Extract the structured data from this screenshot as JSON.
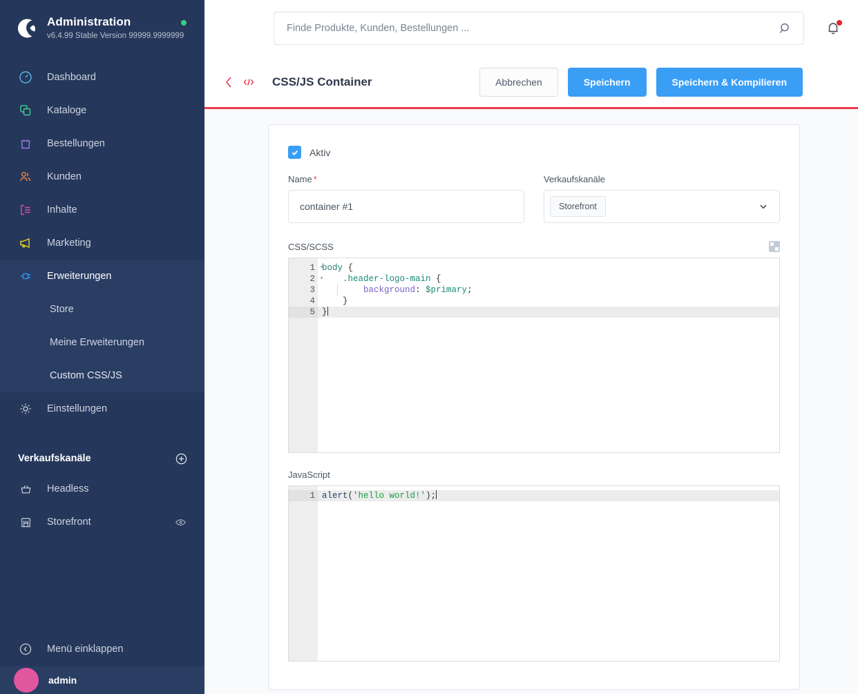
{
  "sidebar": {
    "brand": {
      "logo_icon": "shopware-logo-icon",
      "title": "Administration",
      "version": "v6.4.99 Stable Version 99999.9999999",
      "status_dot_color": "#37d183"
    },
    "nav": [
      {
        "label": "Dashboard",
        "icon": "speedometer-icon",
        "color": "#5ab9e8"
      },
      {
        "label": "Kataloge",
        "icon": "layers-icon",
        "color": "#3ecf8e"
      },
      {
        "label": "Bestellungen",
        "icon": "bag-icon",
        "color": "#9b7ce0"
      },
      {
        "label": "Kunden",
        "icon": "users-icon",
        "color": "#f0873f"
      },
      {
        "label": "Inhalte",
        "icon": "content-icon",
        "color": "#e8499a"
      },
      {
        "label": "Marketing",
        "icon": "megaphone-icon",
        "color": "#ecd426"
      },
      {
        "label": "Erweiterungen",
        "icon": "plug-icon",
        "color": "#2a95f0",
        "active": true
      },
      {
        "label": "Einstellungen",
        "icon": "gear-icon",
        "color": "#c6cdd7"
      }
    ],
    "subnav": [
      {
        "label": "Store"
      },
      {
        "label": "Meine Erweiterungen"
      },
      {
        "label": "Custom CSS/JS",
        "active": true
      }
    ],
    "sales_channels": {
      "title": "Verkaufskanäle",
      "add_icon": "plus-circle-icon",
      "items": [
        {
          "label": "Headless",
          "icon": "basket-icon"
        },
        {
          "label": "Storefront",
          "icon": "storefront-icon",
          "trailing_icon": "eye-icon"
        }
      ]
    },
    "collapse": {
      "label": "Menü einklappen",
      "icon": "chevron-left-circle-icon"
    },
    "user": {
      "name": "admin",
      "avatar_color": "#e0569f"
    }
  },
  "topbar": {
    "search": {
      "placeholder": "Finde Produkte, Kunden, Bestellungen ...",
      "value": "",
      "icon": "search-icon"
    },
    "notifications": {
      "icon": "bell-icon",
      "has_unread": true,
      "dot_color": "#e52427"
    }
  },
  "smartbar": {
    "back_icon": "chevron-left-icon",
    "module_icon": "code-brackets-icon",
    "title": "CSS/JS Container",
    "accent_color": "#ec3a53",
    "buttons": {
      "cancel": "Abbrechen",
      "save": "Speichern",
      "save_compile": "Speichern & Kompilieren"
    }
  },
  "form": {
    "active": {
      "label": "Aktiv",
      "checked": true
    },
    "name": {
      "label": "Name",
      "required": true,
      "value": "container #1",
      "placeholder": ""
    },
    "sales_channels": {
      "label": "Verkaufskanäle",
      "selected": [
        "Storefront"
      ],
      "caret_icon": "chevron-down-icon"
    },
    "css_editor": {
      "label": "CSS/SCSS",
      "expand_icon": "grid-squares-icon",
      "active_line": 5,
      "lines": [
        {
          "n": "1",
          "fold": true,
          "code": "body {"
        },
        {
          "n": "2",
          "fold": true,
          "code": "    .header-logo-main {"
        },
        {
          "n": "3",
          "fold": false,
          "code": "        background: $primary;"
        },
        {
          "n": "4",
          "fold": false,
          "code": "    }"
        },
        {
          "n": "5",
          "fold": false,
          "code": "}"
        }
      ]
    },
    "js_editor": {
      "label": "JavaScript",
      "active_line": 1,
      "lines": [
        {
          "n": "1",
          "fold": false,
          "code": "alert('hello world!');"
        }
      ]
    }
  }
}
